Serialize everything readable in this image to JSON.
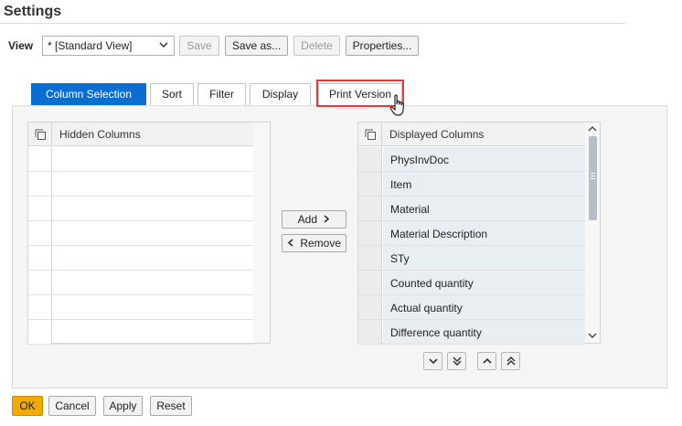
{
  "dialog": {
    "title": "Settings"
  },
  "view_bar": {
    "label": "View",
    "selected_view": "* [Standard View]",
    "buttons": {
      "save": "Save",
      "save_as": "Save as...",
      "delete": "Delete",
      "properties": "Properties..."
    }
  },
  "tabs": [
    {
      "label": "Column Selection",
      "active": true
    },
    {
      "label": "Sort",
      "active": false
    },
    {
      "label": "Filter",
      "active": false
    },
    {
      "label": "Display",
      "active": false
    },
    {
      "label": "Print Version",
      "active": false,
      "highlighted": true
    }
  ],
  "hidden_columns": {
    "header": "Hidden Columns",
    "rows": [
      "",
      "",
      "",
      "",
      "",
      "",
      "",
      ""
    ]
  },
  "transfer_buttons": {
    "add": "Add",
    "remove": "Remove"
  },
  "displayed_columns": {
    "header": "Displayed Columns",
    "rows": [
      "PhysInvDoc",
      "Item",
      "Material",
      "Material Description",
      "STy",
      "Counted quantity",
      "Actual quantity",
      "Difference quantity"
    ]
  },
  "order_buttons": [
    "move-bottom",
    "move-down",
    "move-up",
    "move-top"
  ],
  "footer": {
    "ok": "OK",
    "cancel": "Cancel",
    "apply": "Apply",
    "reset": "Reset"
  },
  "colors": {
    "accent": "#0a6ed1",
    "ok_button": "#f0ab00",
    "highlight_box": "#e23b3b"
  }
}
